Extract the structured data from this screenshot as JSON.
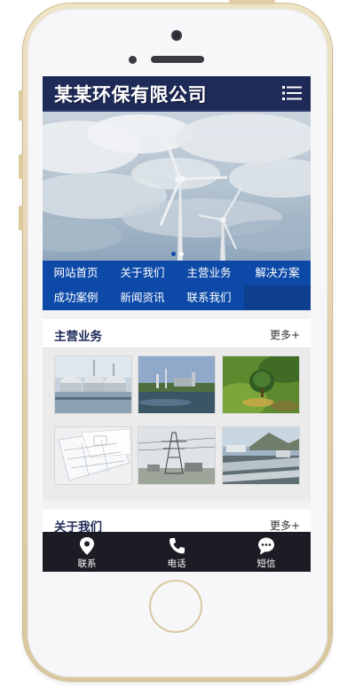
{
  "header": {
    "logo_text": "某某环保有限公司",
    "menu_icon": "hamburger-menu-icon"
  },
  "banner": {
    "image": "wind-turbines-under-cloudy-sky",
    "slide_count": 2,
    "active_slide": 1
  },
  "nav": {
    "items": [
      {
        "label": "网站首页"
      },
      {
        "label": "关于我们"
      },
      {
        "label": "主营业务"
      },
      {
        "label": "解决方案"
      },
      {
        "label": "成功案例"
      },
      {
        "label": "新闻资讯"
      },
      {
        "label": "联系我们"
      }
    ]
  },
  "business": {
    "title": "主营业务",
    "more": "更多+",
    "thumbs": [
      {
        "image": "water-treatment-tanks"
      },
      {
        "image": "lakeside-factory"
      },
      {
        "image": "green-tree-landscape"
      },
      {
        "image": "blueprint-drawings"
      },
      {
        "image": "power-transmission-tower"
      },
      {
        "image": "sewage-treatment-plant"
      }
    ]
  },
  "about": {
    "title": "关于我们",
    "more": "更多+"
  },
  "bottom_bar": {
    "tabs": [
      {
        "label": "联系",
        "icon": "location-pin-icon"
      },
      {
        "label": "电话",
        "icon": "phone-icon"
      },
      {
        "label": "短信",
        "icon": "message-bubble-icon"
      }
    ]
  },
  "colors": {
    "header_bg": "#1e2a57",
    "nav_bg": "#0d4aa8",
    "nav_active_bg": "#0e3f8f",
    "bottom_bar_bg": "#1c1c24",
    "section_title": "#1e2a57",
    "phone_frame": "#e2d2ad"
  }
}
